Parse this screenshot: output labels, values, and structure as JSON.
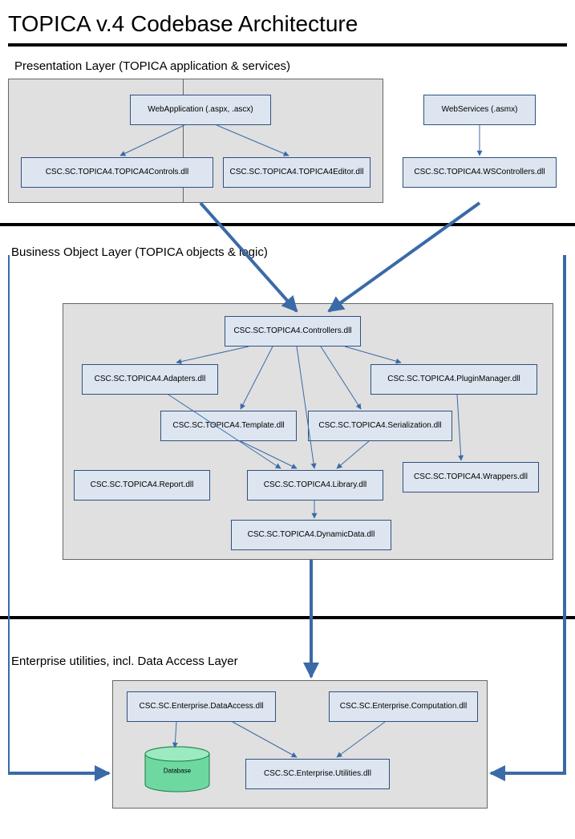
{
  "title": "TOPICA v.4 Codebase Architecture",
  "sections": {
    "presentation": "Presentation Layer (TOPICA application & services)",
    "business": "Business Object Layer (TOPICA objects & logic)",
    "enterprise": "Enterprise utilities, incl. Data Access Layer"
  },
  "boxes": {
    "webapp": "WebApplication (.aspx, .ascx)",
    "webservices": "WebServices (.asmx)",
    "controls": "CSC.SC.TOPICA4.TOPICA4Controls.dll",
    "editor": "CSC.SC.TOPICA4.TOPICA4Editor.dll",
    "wscontrollers": "CSC.SC.TOPICA4.WSControllers.dll",
    "controllers": "CSC.SC.TOPICA4.Controllers.dll",
    "adapters": "CSC.SC.TOPICA4.Adapters.dll",
    "pluginmanager": "CSC.SC.TOPICA4.PluginManager.dll",
    "template": "CSC.SC.TOPICA4.Template.dll",
    "serialization": "CSC.SC.TOPICA4.Serialization.dll",
    "report": "CSC.SC.TOPICA4.Report.dll",
    "library": "CSC.SC.TOPICA4.Library.dll",
    "wrappers": "CSC.SC.TOPICA4.Wrappers.dll",
    "dynamicdata": "CSC.SC.TOPICA4.DynamicData.dll",
    "dataaccess": "CSC.SC.Enterprise.DataAccess.dll",
    "computation": "CSC.SC.Enterprise.Computation.dll",
    "utilities": "CSC.SC.Enterprise.Utilities.dll",
    "database": "Database"
  }
}
